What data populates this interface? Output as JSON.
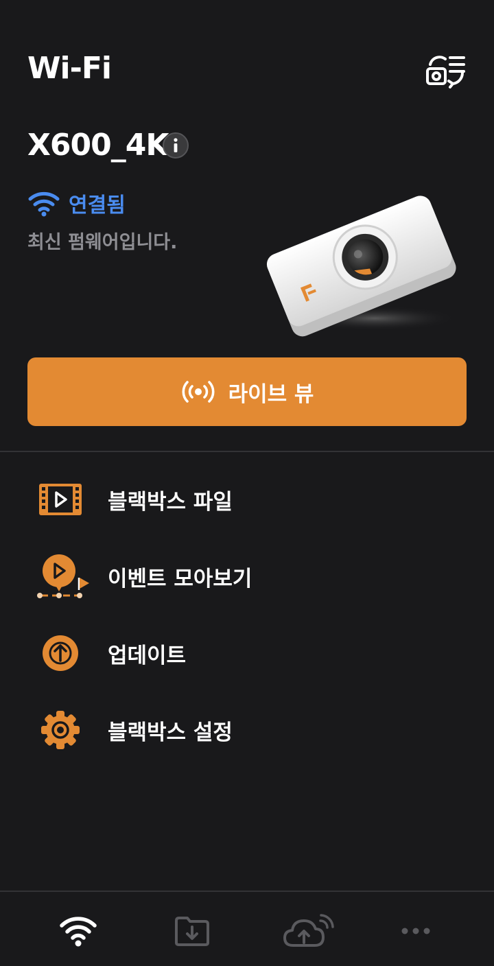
{
  "header": {
    "title": "Wi-Fi",
    "switch_icon": "device-switch-icon"
  },
  "device": {
    "name": "X600_4K",
    "status": "연결됨",
    "firmware": "최신 펌웨어입니다."
  },
  "live_view": {
    "label": "라이브 뷰"
  },
  "menu": [
    {
      "label": "블랙박스 파일",
      "icon": "film-play-icon"
    },
    {
      "label": "이벤트 모아보기",
      "icon": "event-timeline-icon"
    },
    {
      "label": "업데이트",
      "icon": "upload-arrow-icon"
    },
    {
      "label": "블랙박스 설정",
      "icon": "gear-icon"
    }
  ],
  "bottom_nav": [
    {
      "name": "wifi",
      "icon": "wifi-icon",
      "active": true
    },
    {
      "name": "downloads",
      "icon": "folder-download-icon",
      "active": false
    },
    {
      "name": "cloud",
      "icon": "cloud-upload-icon",
      "active": false
    },
    {
      "name": "more",
      "icon": "more-dots-icon",
      "active": false
    }
  ],
  "colors": {
    "background": "#19191b",
    "accent": "#e38a33",
    "connected": "#4a8cf0",
    "muted": "#8e8e93",
    "inactive_icon": "#5a5a5e"
  }
}
